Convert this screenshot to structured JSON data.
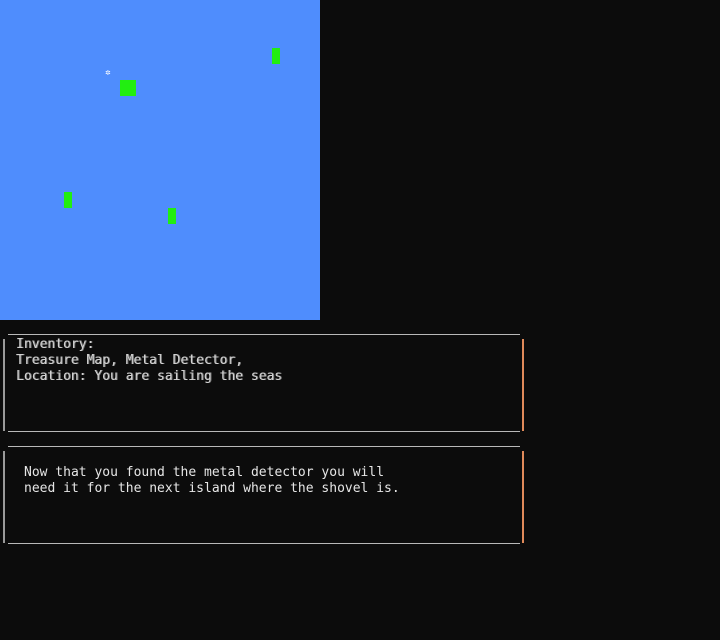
{
  "map": {
    "background": "#4f8dfd",
    "island_color": "#22ee11",
    "player_glyph": "✲"
  },
  "inventory_panel": {
    "heading": "Inventory:",
    "items_line": "Treasure Map, Metal Detector,",
    "location_line": "Location: You are sailing the seas"
  },
  "message_panel": {
    "line1": "Now that you found the metal detector you will",
    "line2": "need it for the next island where the shovel is."
  }
}
